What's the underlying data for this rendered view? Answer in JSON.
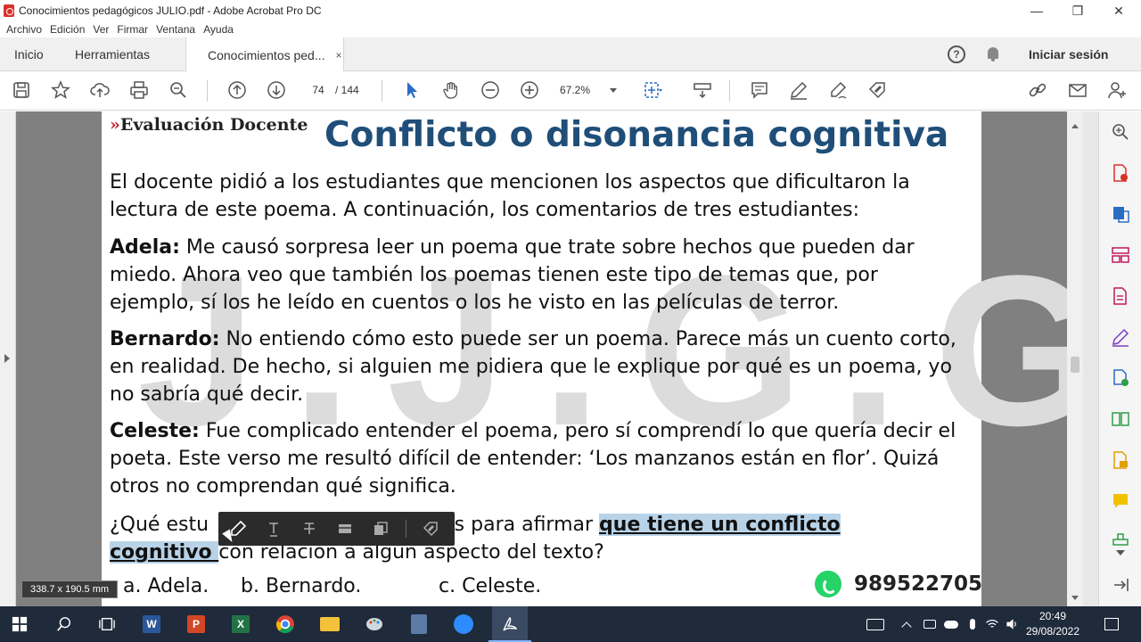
{
  "window": {
    "title": "Conocimientos pedagógicos JULIO.pdf - Adobe Acrobat Pro DC",
    "minimize": "—",
    "maximize": "❐",
    "close": "✕"
  },
  "menu": [
    "Archivo",
    "Edición",
    "Ver",
    "Firmar",
    "Ventana",
    "Ayuda"
  ],
  "tabs": {
    "home": "Inicio",
    "tools": "Herramientas",
    "document": "Conocimientos ped...",
    "close": "×"
  },
  "header": {
    "help": "?",
    "signin": "Iniciar sesión"
  },
  "toolbar": {
    "page_current": "74",
    "page_total": "/  144",
    "zoom": "67.2%"
  },
  "slide": {
    "brand_chevrons": "»",
    "brand": "Evaluación Docente",
    "title": "Conflicto o disonancia cognitiva",
    "intro": "El docente pidió a los estudiantes que mencionen los aspectos que dificultaron la lectura de este poema. A continuación, los comentarios de tres estudiantes:",
    "comments": [
      {
        "name": "Adela:",
        "text": " Me causó sorpresa leer un poema que trate sobre hechos que pueden dar miedo. Ahora veo que también los poemas tienen este tipo de temas que, por ejemplo, sí los he leído en cuentos o los he visto en las películas de terror."
      },
      {
        "name": "Bernardo:",
        "text": " No entiendo cómo esto puede ser un poema. Parece más un cuento corto, en realidad. De hecho, si alguien me pidiera que le explique por qué es un poema, yo no sabría qué decir."
      },
      {
        "name": "Celeste:",
        "text": " Fue complicado entender el poema, pero sí comprendí lo que quería decir el poeta. Este verso me resultó difícil de entender: ‘Los manzanos están en flor’. Quizá otros no comprendan qué significa."
      }
    ],
    "question_start": "¿Qué estu",
    "question_mid": "entes para afirmar ",
    "question_highlight_1": "que tiene un conflicto",
    "question_highlight_2": "cognitivo ",
    "question_end": "con relación a algún aspecto del texto?",
    "options": [
      "a. Adela.",
      "b. Bernardo.",
      "c. Celeste."
    ],
    "phone": "989522705"
  },
  "measure": "338.7 x 190.5 mm",
  "clock": {
    "time": "20:49",
    "date": "29/08/2022"
  },
  "colors": {
    "title_blue": "#1f4e79",
    "brand_red": "#c0272d",
    "highlight": "#b8d3e8",
    "taskbar": "#1f2a3b"
  }
}
